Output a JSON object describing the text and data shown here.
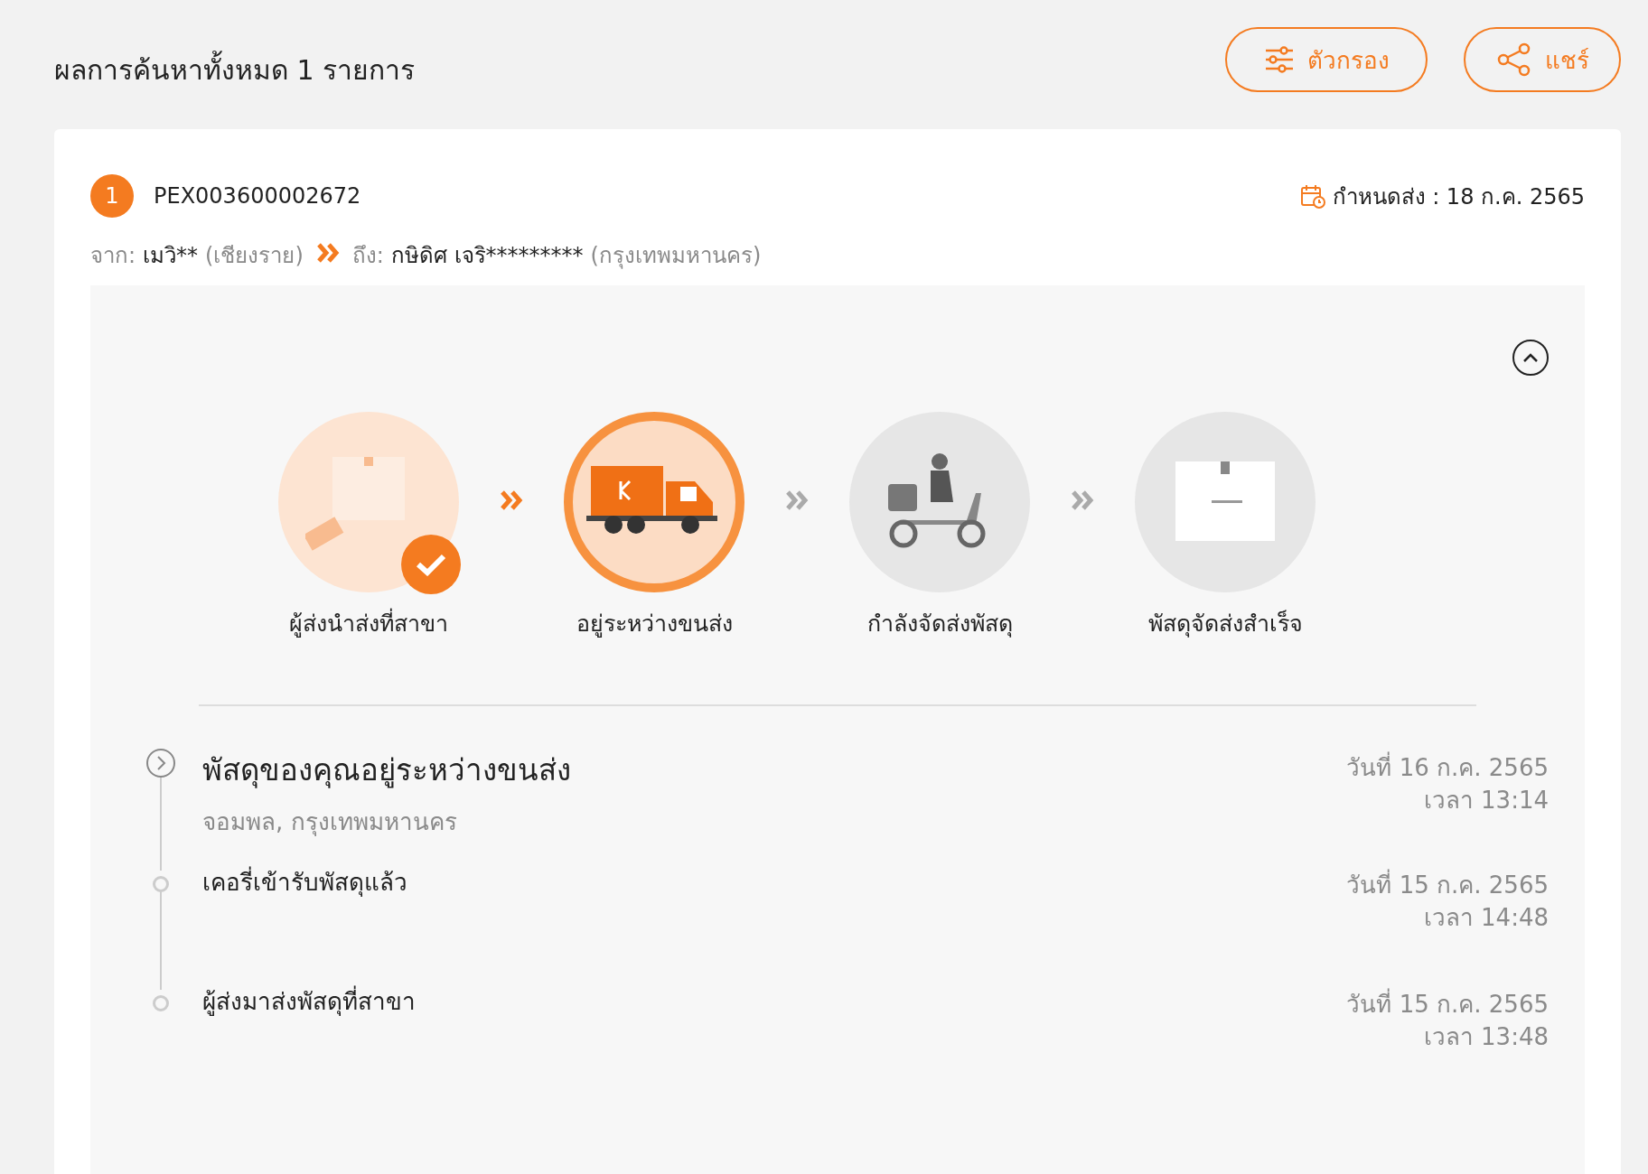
{
  "header": {
    "title": "ผลการค้นหาทั้งหมด 1 รายการ",
    "buttons": [
      {
        "kind": "filter",
        "label": "ตัวกรอง"
      },
      {
        "kind": "share",
        "label": "แชร์"
      }
    ]
  },
  "shipment": {
    "index": "1",
    "tracking_number": "PEX003600002672",
    "due_date": "กำหนดส่ง : 18 ก.ค. 2565",
    "route": {
      "from_label": "จาก:",
      "from_name": "เมวิ**",
      "from_city": "(เชียงราย)",
      "to_label": "ถึง:",
      "to_name": "กษิดิศ เจริ*********",
      "to_city": "(กรุงเทพมหานคร)"
    },
    "expanded": true,
    "steps": [
      {
        "kind": "drop-off",
        "label": "ผู้ส่งนำส่งที่สาขา",
        "checked": true,
        "selected": false
      },
      {
        "kind": "truck",
        "label": "อยู่ระหว่างขนส่ง",
        "checked": false,
        "selected": true
      },
      {
        "kind": "scooter",
        "label": "กำลังจัดส่งพัสดุ",
        "checked": false,
        "selected": false
      },
      {
        "kind": "box",
        "label": "พัสดุจัดส่งสำเร็จ",
        "checked": false,
        "selected": false
      }
    ],
    "events": [
      {
        "kind": "latest",
        "title": "พัสดุของคุณอยู่ระหว่างขนส่ง",
        "location": "จอมพล, กรุงเทพมหานคร",
        "date": "วันที่ 16 ก.ค. 2565",
        "time": "เวลา 13:14"
      },
      {
        "kind": "past",
        "title": "เคอรี่เข้ารับพัสดุแล้ว",
        "date": "วันที่ 15 ก.ค. 2565",
        "time": "เวลา 14:48"
      },
      {
        "kind": "past",
        "title": "ผู้ส่งมาส่งพัสดุที่สาขา",
        "date": "วันที่ 15 ก.ค. 2565",
        "time": "เวลา 13:48"
      }
    ]
  }
}
